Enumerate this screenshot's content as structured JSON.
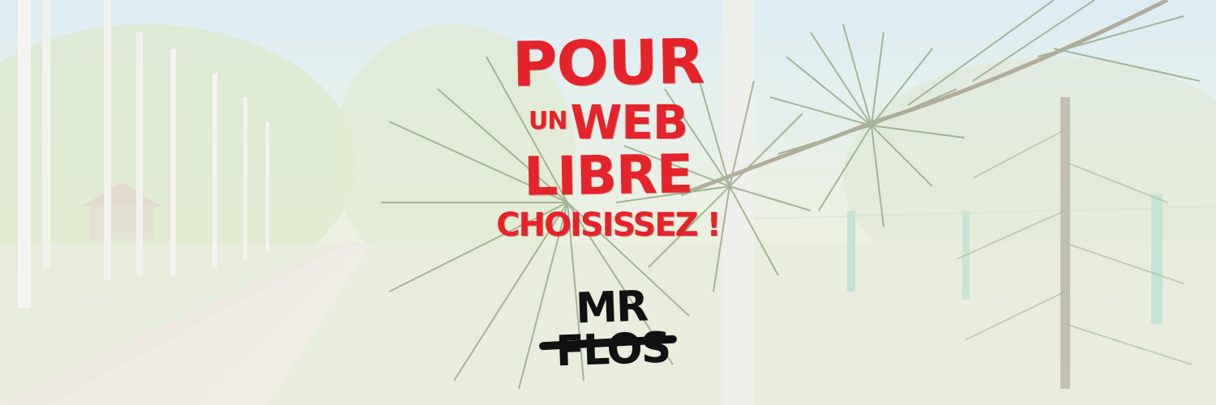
{
  "slogan": {
    "line1": "POUR",
    "line2_small": "UN",
    "line2_big": "WEB",
    "line3": "LIBRE",
    "line4": "CHOISISSEZ !",
    "color": "#e5232a"
  },
  "signature": {
    "text": "MR FLOS",
    "color": "#111111"
  },
  "scene": {
    "description_tags": [
      "birch-trees",
      "dirt-road",
      "pine-branch",
      "sky"
    ],
    "colors": {
      "sky": "#cfe6f1",
      "foliage": "#c9dcae",
      "road": "#e3ddd2",
      "pine": "#6f8a5a",
      "bark": "#efefe8"
    }
  }
}
